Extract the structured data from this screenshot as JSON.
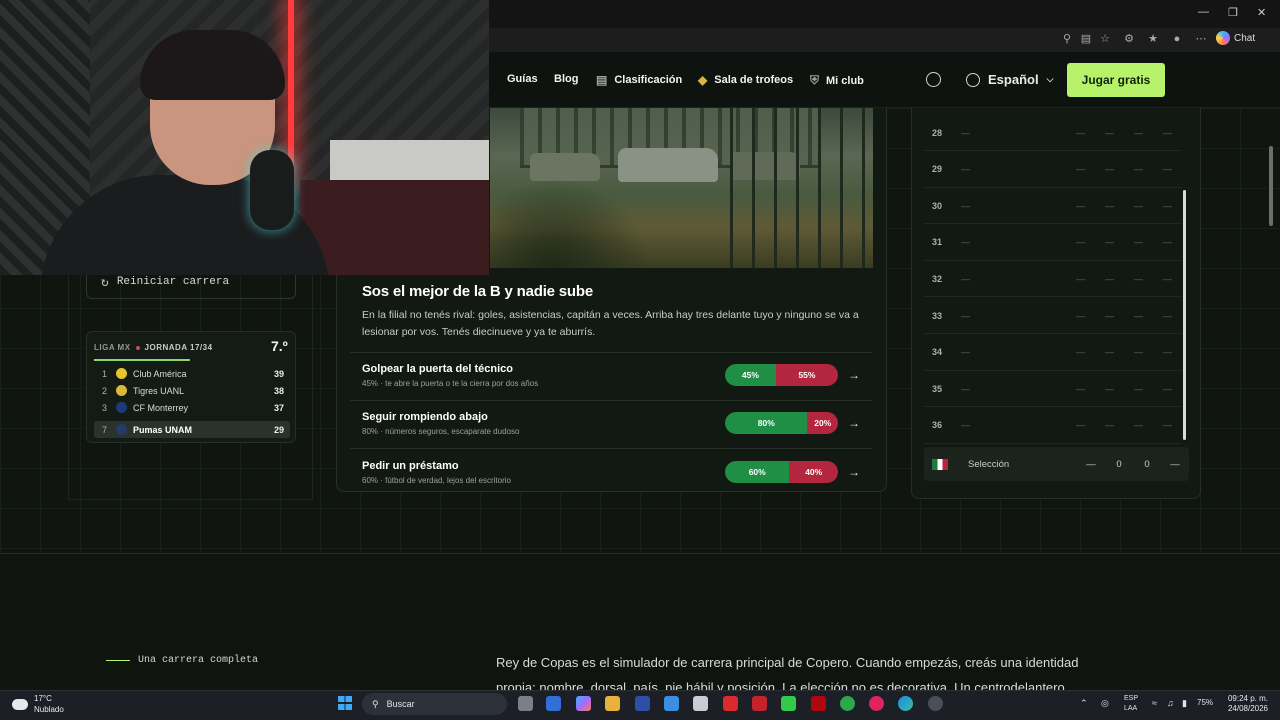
{
  "browser": {
    "chat_label": "Chat"
  },
  "nav": {
    "links": [
      "Guías",
      "Blog",
      "Clasificación",
      "Sala de trofeos",
      "Mi club"
    ],
    "language": "Español",
    "cta": "Jugar gratis"
  },
  "left": {
    "restart_label": "Reiniciar carrera",
    "league": {
      "name": "LIGA MX",
      "round": "JORNADA 17/34",
      "position": "7.º",
      "rows": [
        {
          "pos": "1",
          "team": "Club América",
          "pts": "39",
          "crest_color": "#e6c52b"
        },
        {
          "pos": "2",
          "team": "Tigres UANL",
          "pts": "38",
          "crest_color": "#d9b93a"
        },
        {
          "pos": "3",
          "team": "CF Monterrey",
          "pts": "37",
          "crest_color": "#1f3a7a"
        },
        {
          "pos": "7",
          "team": "Pumas UNAM",
          "pts": "29",
          "crest_color": "#233a6b"
        }
      ]
    }
  },
  "event": {
    "title": "Sos el mejor de la B y nadie sube",
    "description": "En la filial no tenés rival: goles, asistencias, capitán a veces. Arriba hay tres delante tuyo y ninguno se va a lesionar por vos. Tenés diecinueve y ya te aburrís.",
    "options": [
      {
        "title": "Golpear la puerta del técnico",
        "sub": "45% · te abre la puerta o te la cierra por dos años",
        "good": "45%",
        "bad": "55%",
        "good_pct": 45
      },
      {
        "title": "Seguir rompiendo abajo",
        "sub": "80% · números seguros, escaparate dudoso",
        "good": "80%",
        "bad": "20%",
        "good_pct": 80
      },
      {
        "title": "Pedir un préstamo",
        "sub": "60% · fútbol de verdad, lejos del escritorio",
        "good": "60%",
        "bad": "40%",
        "good_pct": 60
      }
    ]
  },
  "calendar": {
    "rows": [
      "28",
      "29",
      "30",
      "31",
      "32",
      "33",
      "34",
      "35",
      "36"
    ],
    "dash": "—",
    "selection": {
      "label": "Selección",
      "c1": "—",
      "c2": "0",
      "c3": "0",
      "c4": "—"
    }
  },
  "lower": {
    "section_label": "Una carrera completa",
    "text": "Rey de Copas es el simulador de carrera principal de Copero. Cuando empezás, creás una identidad propia: nombre, dorsal, país, pie hábil y posición. La elección no es decorativa. Un centrodelantero"
  },
  "taskbar": {
    "temp": "17°C",
    "weather": "Nublado",
    "search": "Buscar",
    "lang_top": "ESP",
    "lang_bottom": "LAA",
    "battery": "75%",
    "time": "09:24 p. m.",
    "date": "24/08/2026"
  }
}
